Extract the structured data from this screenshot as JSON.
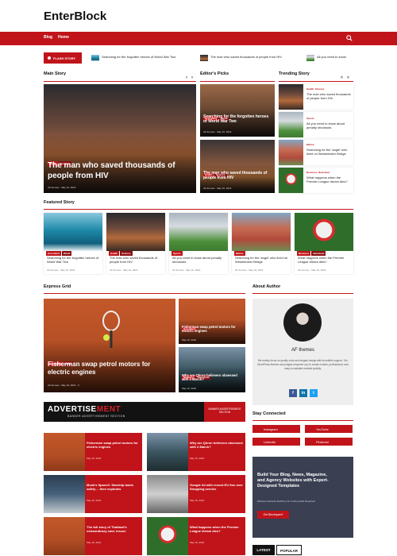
{
  "header": {
    "logo": "EnterBlock"
  },
  "nav": {
    "items": [
      "Blog",
      "Home"
    ]
  },
  "flash": {
    "label": "FLASH STORY",
    "items": [
      "Searching for the forgotten heroes of World War Two",
      "The man who saved thousands of people from HIV",
      "All you need to know"
    ]
  },
  "sections": {
    "main_story": "Main Story",
    "editors_picks": "Editor's Picks",
    "trending_story": "Trending Story",
    "featured_story": "Featured Story",
    "express_grid": "Express Grid",
    "about_author": "About Author",
    "stay_connected": "Stay Connected"
  },
  "main_story": {
    "categories": [
      "Health",
      "Science"
    ],
    "title": "The man who saved thousands of people from HIV",
    "author": "AF themes",
    "date": "May 16, 2024"
  },
  "editors_picks": [
    {
      "categories": [
        "Greenland",
        "World"
      ],
      "title": "Searching for the forgotten heroes of World War Two",
      "author": "AF themes",
      "date": "May 16, 2024"
    },
    {
      "categories": [
        "Health",
        "Science"
      ],
      "title": "The man who saved thousands of people from HIV",
      "author": "AF themes",
      "date": "May 16, 2024"
    }
  ],
  "trending": [
    {
      "category": "Health, Science",
      "title": "The man who saved thousands of people from HIV"
    },
    {
      "category": "Sports",
      "title": "All you need to know about penalty shootouts"
    },
    {
      "category": "Marine",
      "title": "Searching for the 'angel' who lived on Westminster Bridge"
    },
    {
      "category": "Business, Newsfeed",
      "title": "What happens when the Premier League dream dies?"
    }
  ],
  "featured": [
    {
      "categories": [
        "Greenland",
        "World"
      ],
      "title": "Searching for the forgotten heroes of World War Two",
      "author": "AF themes",
      "date": "May 16, 2024"
    },
    {
      "categories": [
        "Health",
        "Science"
      ],
      "title": "The man who saved thousands of people from HIV",
      "author": "AF themes",
      "date": "May 16, 2024"
    },
    {
      "categories": [
        "Sports"
      ],
      "title": "All you need to know about penalty shootouts",
      "author": "AF themes",
      "date": "May 16, 2024"
    },
    {
      "categories": [
        "Marine"
      ],
      "title": "Searching for the 'angel' who lived on Westminster Bridge",
      "author": "AF themes",
      "date": "May 16, 2024"
    },
    {
      "categories": [
        "Business",
        "Newsfeed"
      ],
      "title": "What happens when the Premier League dream dies?",
      "author": "AF themes",
      "date": "May 16, 2024"
    }
  ],
  "express": {
    "big": {
      "categories": [
        "Greenland",
        "World"
      ],
      "title": "Fisherman swap petrol motors for electric engines",
      "author": "AF themes",
      "date": "May 16, 2024",
      "comments": "0"
    },
    "small": [
      {
        "categories": [
          "Greenland"
        ],
        "title": "Fisherman swap petrol motors for electric engines",
        "date": "May 16, 2024"
      },
      {
        "categories": [
          "Business",
          "Newsfeed"
        ],
        "title": "Why are Qhron believers obsessed with 4 March?",
        "date": "May 16, 2024"
      }
    ],
    "list": [
      {
        "title": "Fisherman swap petrol motors for electric engines",
        "date": "May 16, 2024"
      },
      {
        "title": "Why are Qhron believers obsessed with 4 March?",
        "date": "May 16, 2024"
      },
      {
        "title": "Musk's SpaceX: Starship lands safely… then explodes",
        "date": "May 16, 2024"
      },
      {
        "title": "Google hit with record EU fine over Shopping service",
        "date": "May 16, 2024"
      },
      {
        "title": "The full story of Thailand's extraordinary cave rescue",
        "date": "May 16, 2024"
      },
      {
        "title": "What happens when the Premier League dream dies?",
        "date": "May 16, 2024"
      }
    ]
  },
  "ad": {
    "main_1": "ADVERTISE",
    "main_2": "MENT",
    "sub": "BANNER ADVERTISEMENT SECTION",
    "right": "BANNER ADVERTISEMENT SECTION"
  },
  "about": {
    "name": "AF themes",
    "description": "We mainly focus on quality code and elegant design with incredible support. Our WordPress themes and plugins empower you to create a sleek, professional, and easy-to-maintain website quickly."
  },
  "stay": [
    {
      "label": "Instagram",
      "color": "#c0141a"
    },
    {
      "label": "YouTube",
      "color": "#c0141a"
    },
    {
      "label": "LinkedIn",
      "color": "#c0141a"
    },
    {
      "label": "Pinterest",
      "color": "#c0141a"
    }
  ],
  "blocks_ad": {
    "title": "Build Your Blog, News, Magazine, and Agency Websites with Expert-Designed Templates",
    "sub": "Effortless Website Building: No Coding Skills Required!",
    "button": "Get Blockspare!"
  },
  "tabs": [
    "LATEST",
    "POPULAR"
  ],
  "colors": {
    "accent": "#c0141a",
    "dark": "#121212"
  }
}
